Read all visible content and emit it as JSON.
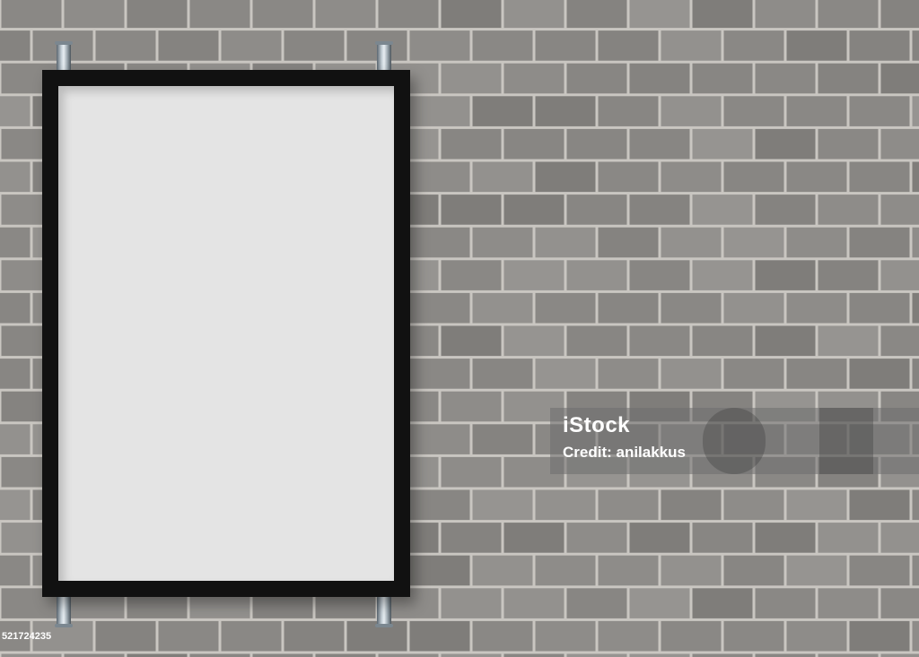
{
  "scene": {
    "wall_color": "#8c8a87",
    "mortar_color": "#c9c6c1",
    "frame_color": "#111111",
    "panel_color": "#e4e4e4"
  },
  "watermark": {
    "logo": "iStock",
    "credit": "Credit: anilakkus"
  },
  "image_id": "521724235"
}
